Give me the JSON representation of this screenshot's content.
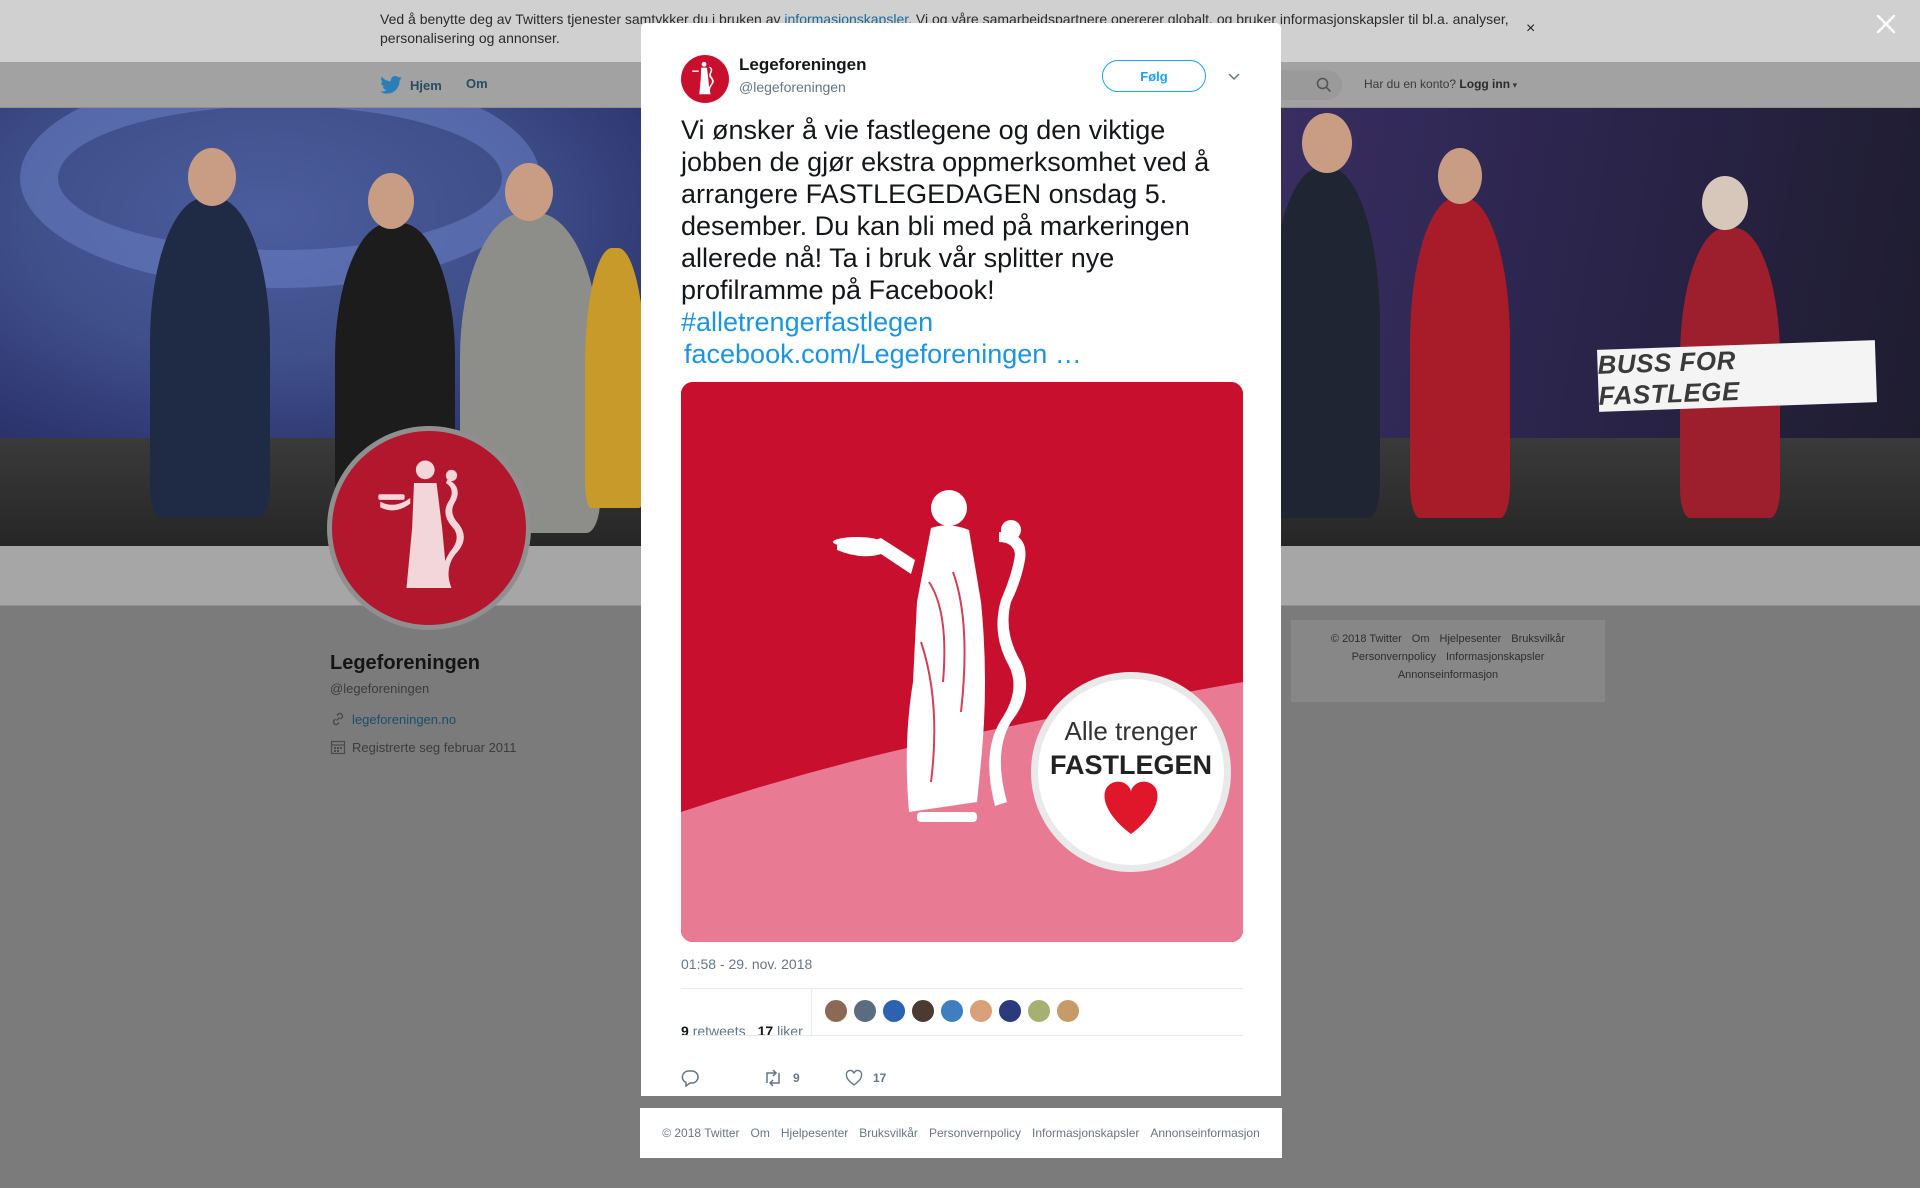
{
  "cookie_bar": {
    "text_before": "Ved å benytte deg av Twitters tjenester samtykker du i bruken av ",
    "link": "informasjonskapsler",
    "text_after": ". Vi og våre samarbeidspartnere opererer globalt, og bruker informasjonskapsler til bl.a. analyser, personalisering og annonser.",
    "close_icon": "×"
  },
  "nav": {
    "home": "Hjem",
    "about": "Om",
    "login_prompt": "Har du en konto?",
    "login": "Logg inn"
  },
  "banner": {
    "sign_text": "BUSS FOR FASTLEGE"
  },
  "profile": {
    "name": "Legeforeningen",
    "handle": "@legeforeningen",
    "website": "legeforeningen.no",
    "joined": "Registrerte seg februar 2011"
  },
  "side_footer": {
    "links": [
      "© 2018 Twitter",
      "Om",
      "Hjelpesenter",
      "Bruksvilkår",
      "Personvernpolicy",
      "Informasjonskapsler",
      "Annonseinformasjon"
    ]
  },
  "tweet": {
    "author_name": "Legeforeningen",
    "author_handle": "@legeforeningen",
    "follow_label": "Følg",
    "text": "Vi ønsker å vie fastlegene og den viktige jobben de gjør ekstra oppmerksomhet ved å arrangere FASTLEGEDAGEN onsdag 5. desember. Du kan bli med på markeringen allerede nå! Ta i bruk vår splitter nye profilramme på Facebook!",
    "hashtag": "#alletrengerfastlegen",
    "link": "facebook.com/Legeforeningen …",
    "image_text_line1": "Alle trenger",
    "image_text_line2": "FASTLEGEN",
    "timestamp": "01:58 - 29. nov. 2018",
    "retweets_count": "9",
    "retweets_label": "retweets",
    "likes_count": "17",
    "likes_label": "liker",
    "action_retweet_count": "9",
    "action_like_count": "17",
    "liker_colors": [
      "#8a6a52",
      "#5b6b80",
      "#2d62b0",
      "#4a3a32",
      "#3f7fc0",
      "#d9a07a",
      "#2a3a7a",
      "#a6b070",
      "#c79a6a"
    ]
  },
  "modal_footer": {
    "links": [
      "© 2018 Twitter",
      "Om",
      "Hjelpesenter",
      "Bruksvilkår",
      "Personvernpolicy",
      "Informasjonskapsler",
      "Annonseinformasjon"
    ]
  },
  "colors": {
    "twitter_blue": "#1da1f2",
    "brand_red": "#c8102e",
    "link_blue": "#1b95e0"
  }
}
